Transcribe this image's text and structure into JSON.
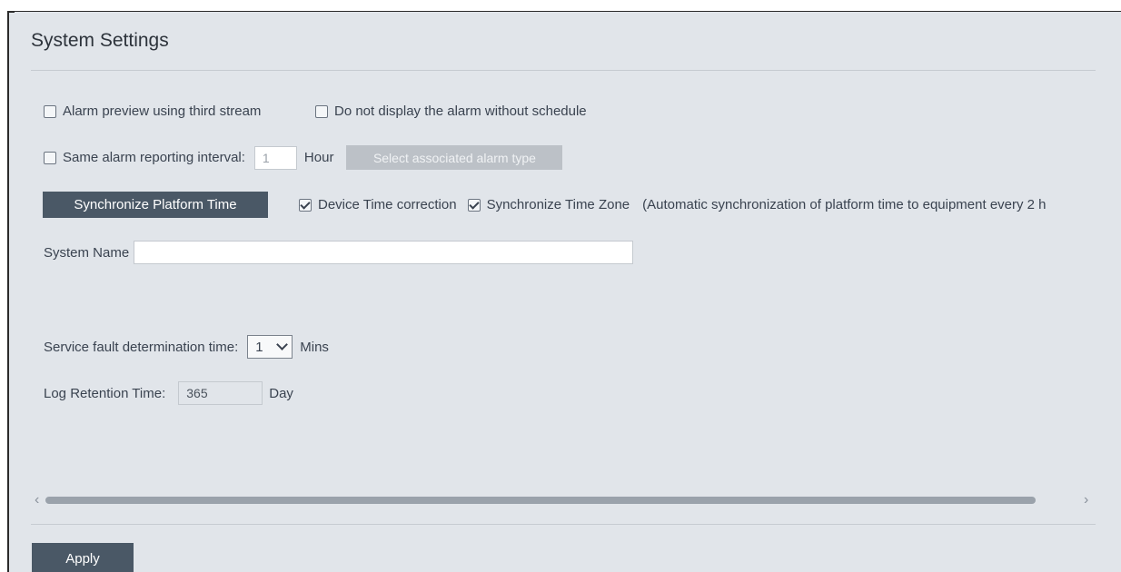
{
  "page": {
    "title": "System Settings"
  },
  "alarm": {
    "third_stream_label": "Alarm preview using third stream",
    "third_stream_checked": false,
    "no_schedule_label": "Do not display the alarm without schedule",
    "no_schedule_checked": false,
    "interval_label": "Same alarm reporting interval:",
    "interval_checked": false,
    "interval_value": "1",
    "interval_unit": "Hour",
    "select_type_button": "Select associated alarm type"
  },
  "time_sync": {
    "sync_button": "Synchronize Platform Time",
    "device_correction_label": "Device Time correction",
    "device_correction_checked": true,
    "sync_zone_label": "Synchronize Time Zone",
    "sync_zone_checked": true,
    "auto_note": "(Automatic synchronization of platform time to equipment every 2 h"
  },
  "system_name": {
    "label": "System Name",
    "value": ""
  },
  "service_fault": {
    "label": "Service fault determination time:",
    "selected": "1",
    "unit": "Mins"
  },
  "log_retention": {
    "label": "Log Retention Time:",
    "value": "365",
    "unit": "Day"
  },
  "footer": {
    "apply_button": "Apply"
  },
  "icons": {
    "scroll_left": "chevron-left-icon",
    "scroll_right": "chevron-right-icon",
    "dropdown": "chevron-down-icon",
    "checkbox_checked": "checkmark-icon"
  }
}
